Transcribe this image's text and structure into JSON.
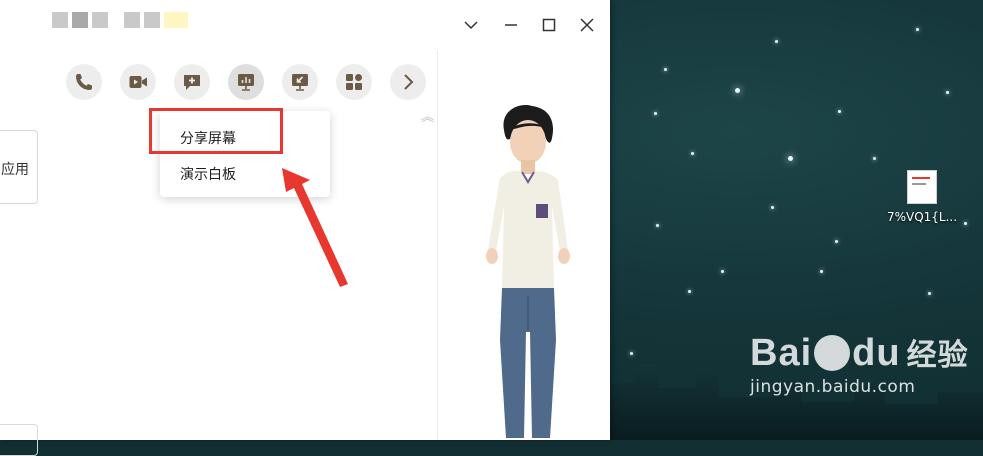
{
  "desktop": {
    "icon_label": "7%VQ1{L...",
    "watermark": {
      "logo_prefix": "Bai",
      "logo_suffix": "du",
      "logo_cn": "经验",
      "url": "jingyan.baidu.com"
    }
  },
  "window": {
    "left_panel": {
      "card_text": "应用"
    },
    "toolbar": {
      "icons": [
        "phone-icon",
        "video-icon",
        "chat-add-icon",
        "present-icon",
        "screen-share-icon",
        "apps-icon",
        "chevron-right-icon"
      ],
      "active": "present-icon"
    },
    "dropdown": {
      "items": [
        "分享屏幕",
        "演示白板"
      ],
      "highlighted_item": "分享屏幕"
    }
  },
  "colors": {
    "highlight": "#e8372f",
    "toolbar_icon": "#6b5a45",
    "toolbar_bg": "#ededed"
  }
}
